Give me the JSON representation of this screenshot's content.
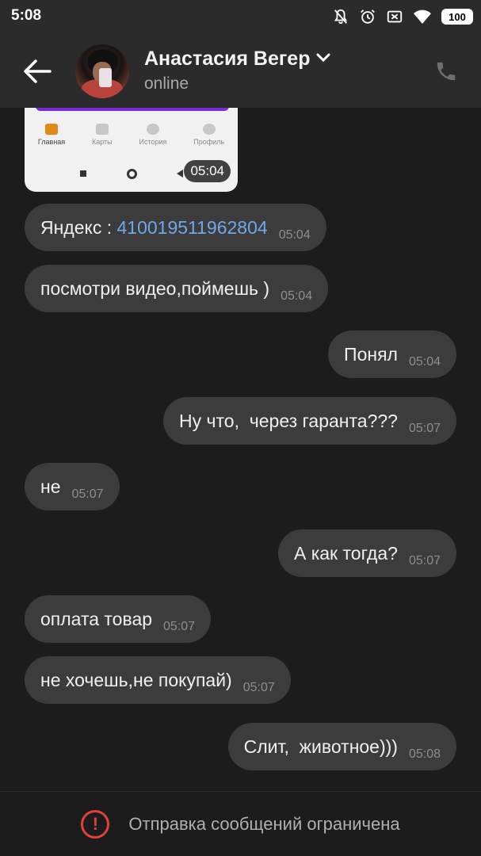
{
  "status_bar": {
    "time": "5:08",
    "battery": "100",
    "icons": [
      "bell-off-icon",
      "alarm-icon",
      "sim-off-icon",
      "wifi-icon",
      "battery-icon"
    ]
  },
  "header": {
    "contact_name": "Анастасия Вегер",
    "status": "online",
    "icons": [
      "back-arrow-icon",
      "chevron-down-icon",
      "phone-icon"
    ]
  },
  "image_message": {
    "time": "05:04",
    "nav_items": [
      "Главная",
      "Карты",
      "История",
      "Профиль"
    ]
  },
  "messages": [
    {
      "direction": "in",
      "text": "Яндекс : ",
      "link": "410019511962804",
      "time": "05:04"
    },
    {
      "direction": "in",
      "text": "посмотри видео,поймешь )",
      "time": "05:04"
    },
    {
      "direction": "out",
      "text": "Понял",
      "time": "05:04"
    },
    {
      "direction": "out",
      "text": "Ну что,  через гаранта???",
      "time": "05:07"
    },
    {
      "direction": "in",
      "text": "не",
      "time": "05:07"
    },
    {
      "direction": "out",
      "text": "А как тогда?",
      "time": "05:07"
    },
    {
      "direction": "in",
      "text": "оплата товар",
      "time": "05:07"
    },
    {
      "direction": "in",
      "text": "не хочешь,не покупай)",
      "time": "05:07"
    },
    {
      "direction": "out",
      "text": "Слит,  животное)))",
      "time": "05:08"
    }
  ],
  "footer": {
    "text": "Отправка сообщений ограничена",
    "icon": "warning-icon"
  },
  "colors": {
    "background": "#1c1c1c",
    "header": "#2b2b2b",
    "bubble": "#3c3c3c",
    "link": "#6fa8ea",
    "warning": "#e0413f"
  }
}
